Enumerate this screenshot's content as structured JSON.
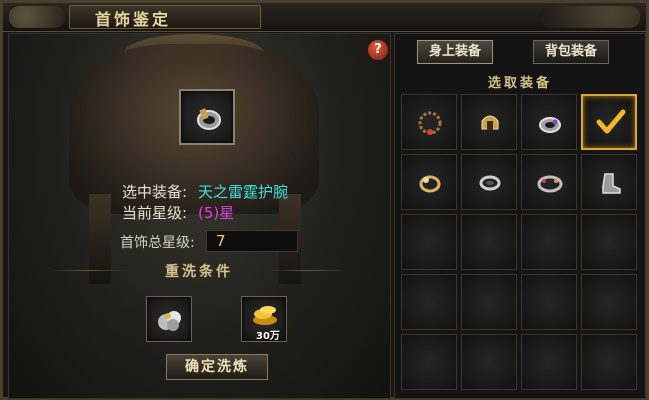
{
  "window": {
    "title": "首饰鉴定"
  },
  "help": {
    "label": "?"
  },
  "selected": {
    "equip_label": "选中装备:",
    "equip_value": "天之雷霆护腕",
    "star_label": "当前星级:",
    "star_value": "(5)星",
    "total_label": "首饰总星级:",
    "total_value": "7"
  },
  "conditions": {
    "header": "重洗条件",
    "items": [
      {
        "icon": "silver-ore-icon",
        "label": ""
      },
      {
        "icon": "gold-coins-icon",
        "label": "30万"
      }
    ]
  },
  "confirm_button": "确定洗炼",
  "tabs": [
    {
      "label": "身上装备",
      "active": true
    },
    {
      "label": "背包装备",
      "active": false
    }
  ],
  "select_header": "选取装备",
  "grid": {
    "columns": 4,
    "rows": 5,
    "items": [
      {
        "icon": "necklace-icon"
      },
      {
        "icon": "helmet-icon"
      },
      {
        "icon": "bracer-icon"
      },
      {
        "icon": "checkmark-icon",
        "selected": true
      },
      {
        "icon": "ring-icon"
      },
      {
        "icon": "ring-icon"
      },
      {
        "icon": "bracelet-icon"
      },
      {
        "icon": "boot-icon"
      }
    ]
  },
  "colors": {
    "cyan_value": "#3fe0e0",
    "magenta_value": "#e040e0",
    "gold_value": "#f2d44a",
    "selected_border": "#d9a82e"
  }
}
